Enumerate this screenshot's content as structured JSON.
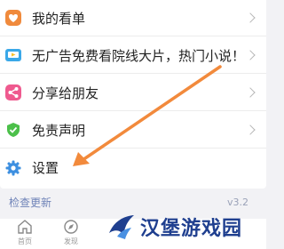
{
  "menu": [
    {
      "label": "我的看单",
      "icon": "heart-icon",
      "color": "#f08a3c"
    },
    {
      "label": "无广告免费看院线大片，热门小说！",
      "icon": "screen-icon",
      "color": "#3aa8e8"
    },
    {
      "label": "分享给朋友",
      "icon": "share-icon",
      "color": "#ef5a8f"
    },
    {
      "label": "免责声明",
      "icon": "shield-icon",
      "color": "#4cc04a"
    },
    {
      "label": "设置",
      "icon": "gear-icon",
      "color": "#3d8fe0"
    }
  ],
  "update": {
    "label": "检查更新",
    "version": "v3.2"
  },
  "tabs": [
    {
      "label": "首页",
      "icon": "home-icon"
    },
    {
      "label": "发现",
      "icon": "compass-icon"
    }
  ],
  "annotation": {
    "color": "#f28a3c",
    "target": "设置"
  },
  "watermark": {
    "text": "汉堡游戏园"
  }
}
